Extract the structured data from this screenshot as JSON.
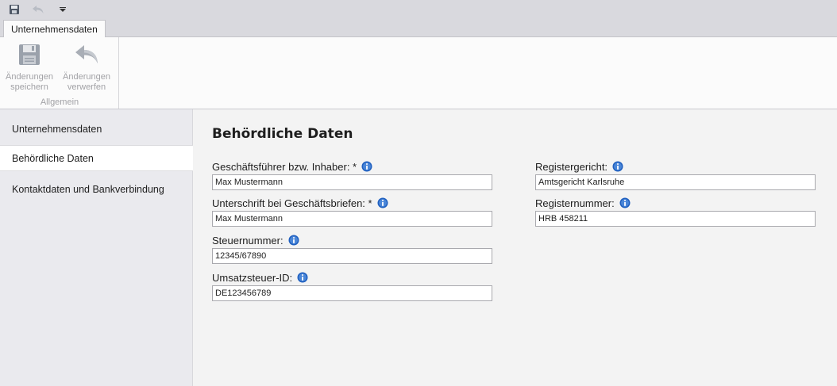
{
  "quick_access": {
    "icons": [
      "save-icon",
      "undo-icon",
      "customize-dropdown-icon"
    ]
  },
  "ribbon": {
    "tab_label": "Unternehmensdaten",
    "group_label": "Allgemein",
    "save_label": "Änderungen\nspeichern",
    "discard_label": "Änderungen\nverwerfen",
    "disabled_color": "#a2a2a6"
  },
  "sidebar": {
    "items": [
      {
        "label": "Unternehmensdaten",
        "active": false
      },
      {
        "label": "Behördliche Daten",
        "active": true
      },
      {
        "label": "Kontaktdaten und Bankverbindung",
        "active": false
      }
    ]
  },
  "main": {
    "title": "Behördliche Daten",
    "fields": {
      "geschaeftsfuehrer": {
        "label": "Geschäftsführer bzw. Inhaber: *",
        "value": "Max Mustermann"
      },
      "unterschrift": {
        "label": "Unterschrift bei Geschäftsbriefen: *",
        "value": "Max Mustermann"
      },
      "steuernummer": {
        "label": "Steuernummer:",
        "value": "12345/67890"
      },
      "ustid": {
        "label": "Umsatzsteuer-ID:",
        "value": "DE123456789"
      },
      "registergericht": {
        "label": "Registergericht:",
        "value": "Amtsgericht Karlsruhe"
      },
      "registernummer": {
        "label": "Registernummer:",
        "value": "HRB 458211"
      }
    },
    "info_icon_color": "#1f5fbf"
  }
}
